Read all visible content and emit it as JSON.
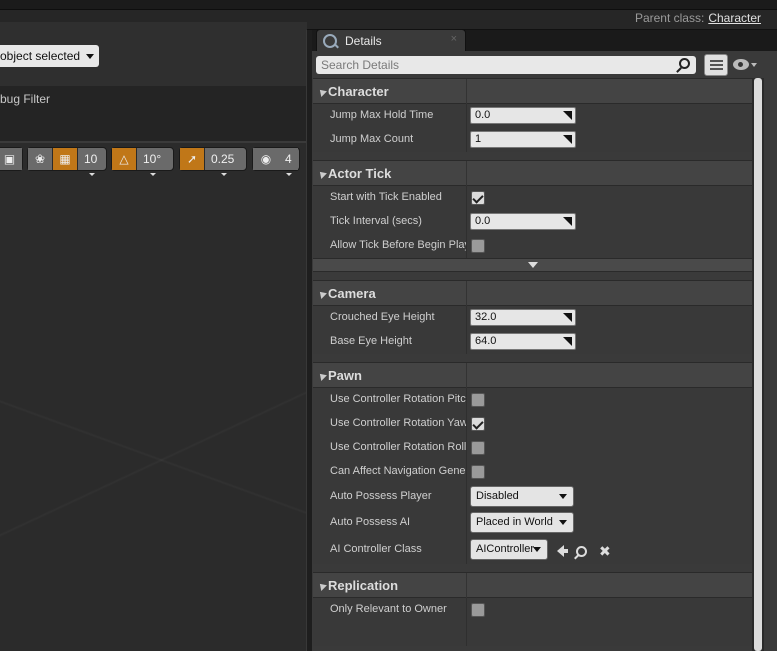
{
  "header": {
    "parent_class_label": "Parent class:",
    "parent_class_value": "Character"
  },
  "left_panel": {
    "object_select_label": "object selected",
    "debug_filter_label": "bug Filter",
    "toolbar": {
      "grid_snap": "10",
      "rotation_snap": "10°",
      "scale_snap": "0.25",
      "camera_speed": "4"
    }
  },
  "details_tab": {
    "label": "Details",
    "close": "×"
  },
  "search": {
    "placeholder": "Search Details"
  },
  "categories": {
    "character": {
      "title": "Character",
      "jump_max_hold_time": {
        "label": "Jump Max Hold Time",
        "value": "0.0"
      },
      "jump_max_count": {
        "label": "Jump Max Count",
        "value": "1"
      }
    },
    "actor_tick": {
      "title": "Actor Tick",
      "start_with_tick_enabled": {
        "label": "Start with Tick Enabled",
        "checked": true
      },
      "tick_interval": {
        "label": "Tick Interval (secs)",
        "value": "0.0"
      },
      "allow_tick_before_begin_play": {
        "label": "Allow Tick Before Begin Play",
        "checked": false
      }
    },
    "camera": {
      "title": "Camera",
      "crouched_eye_height": {
        "label": "Crouched Eye Height",
        "value": "32.0"
      },
      "base_eye_height": {
        "label": "Base Eye Height",
        "value": "64.0"
      }
    },
    "pawn": {
      "title": "Pawn",
      "use_controller_rotation_pitch": {
        "label": "Use Controller Rotation Pitch",
        "checked": false
      },
      "use_controller_rotation_yaw": {
        "label": "Use Controller Rotation Yaw",
        "checked": true
      },
      "use_controller_rotation_roll": {
        "label": "Use Controller Rotation Roll",
        "checked": false
      },
      "can_affect_navigation": {
        "label": "Can Affect Navigation Generation",
        "checked": false
      },
      "auto_possess_player": {
        "label": "Auto Possess Player",
        "value": "Disabled"
      },
      "auto_possess_ai": {
        "label": "Auto Possess AI",
        "value": "Placed in World"
      },
      "ai_controller_class": {
        "label": "AI Controller Class",
        "value": "AIController"
      }
    },
    "replication": {
      "title": "Replication",
      "only_relevant_to_owner": {
        "label": "Only Relevant to Owner",
        "checked": false
      }
    }
  },
  "colors": {
    "accent_orange": "#c07718",
    "panel_bg": "#3a3a3a",
    "category_bg": "#444444"
  }
}
